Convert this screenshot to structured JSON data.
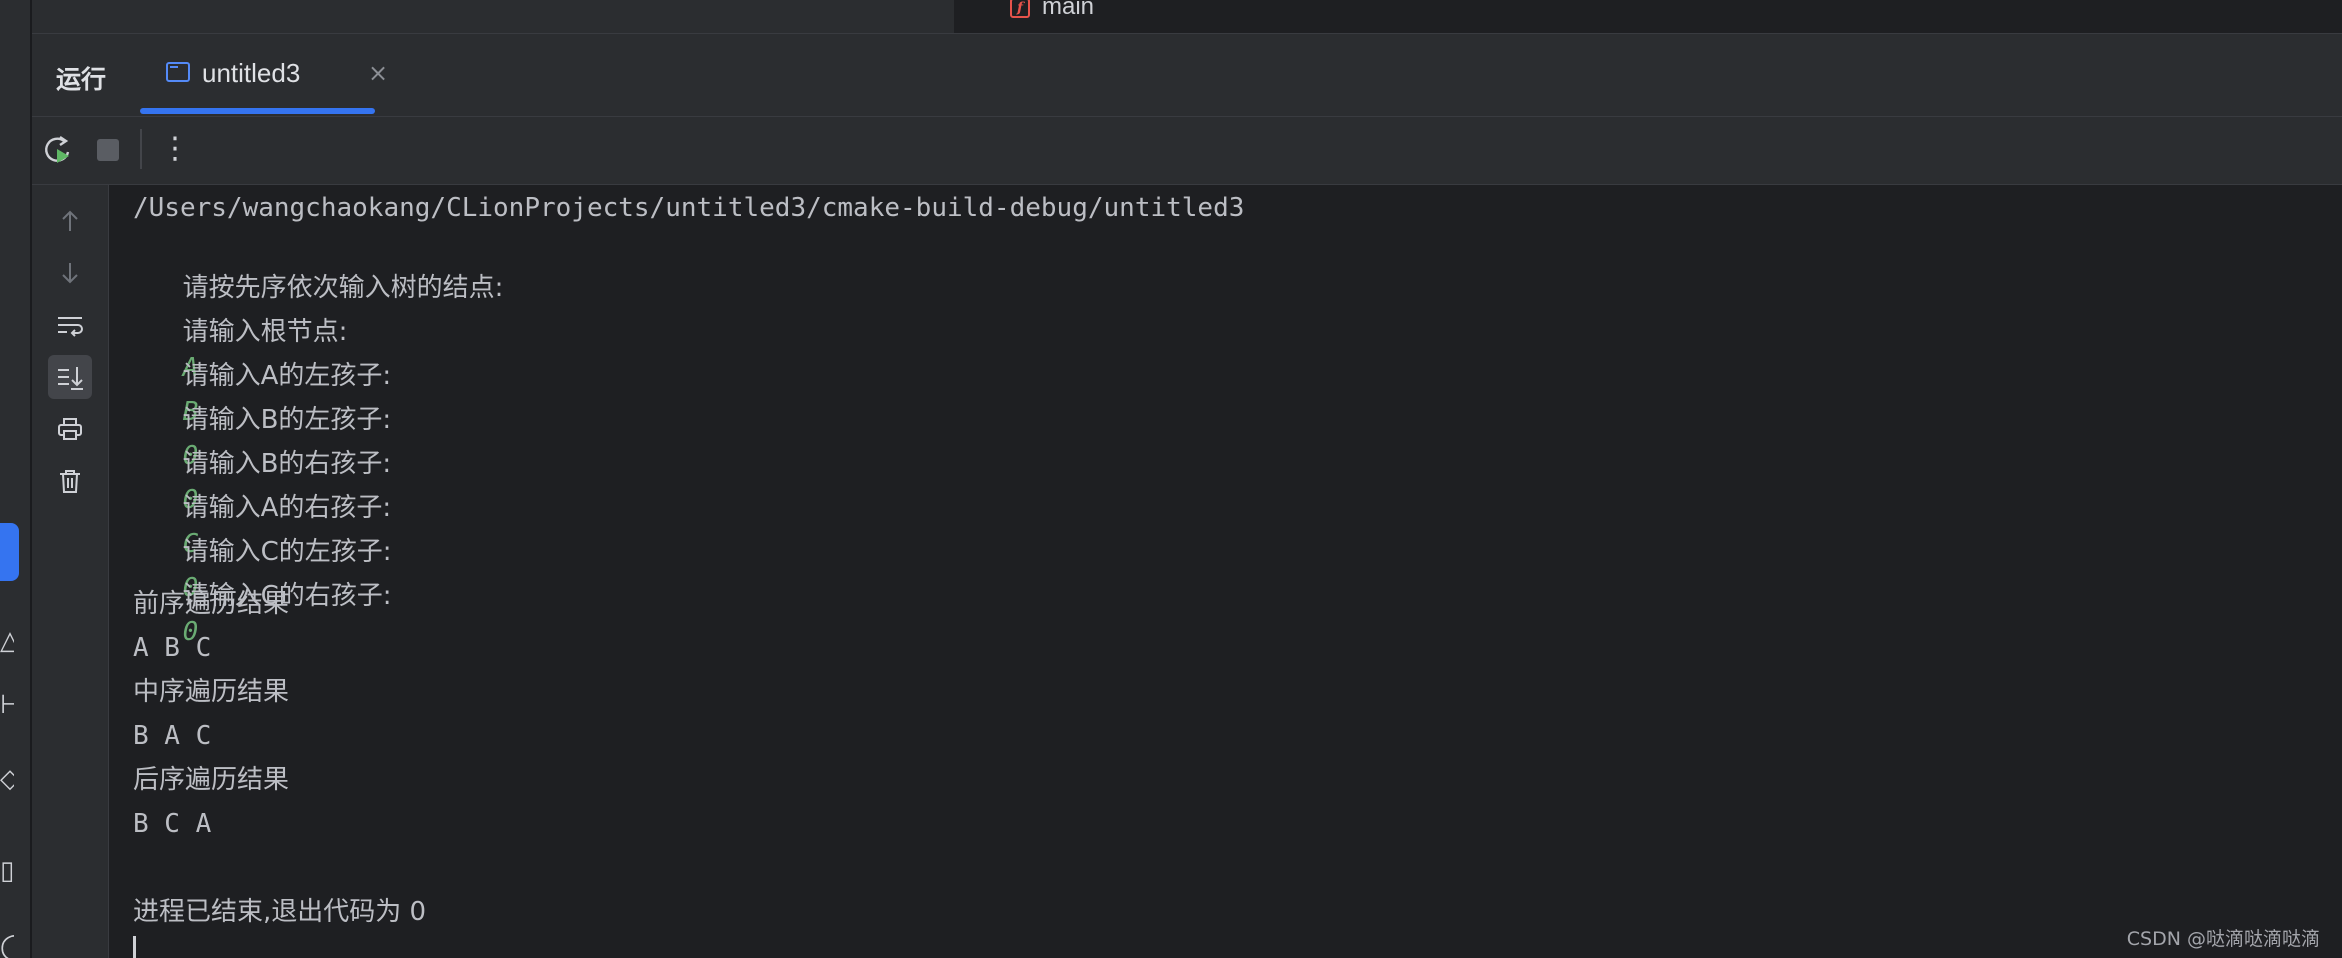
{
  "editor": {
    "tab_label": "main",
    "tab_icon": "function-icon"
  },
  "tool_window": {
    "title": "运行",
    "tab_label": "untitled3",
    "close_glyph": "×",
    "accent_color": "#3574f0"
  },
  "toolbar": {
    "more_glyph": "⋮"
  },
  "console": {
    "path": "/Users/wangchaokang/CLionProjects/untitled3/cmake-build-debug/untitled3",
    "lines": [
      {
        "prompt": "请按先序依次输入树的结点:",
        "input": ""
      },
      {
        "prompt": "请输入根节点:",
        "input": "A"
      },
      {
        "prompt": "请输入A的左孩子:",
        "input": "B"
      },
      {
        "prompt": "请输入B的左孩子:",
        "input": "0"
      },
      {
        "prompt": "请输入B的右孩子:",
        "input": "0"
      },
      {
        "prompt": "请输入A的右孩子:",
        "input": "C"
      },
      {
        "prompt": "请输入C的左孩子:",
        "input": "0"
      },
      {
        "prompt": "请输入C的右孩子:",
        "input": "0"
      }
    ],
    "preorder_label": "前序遍历结果",
    "preorder_result": "A B C",
    "inorder_label": "中序遍历结果",
    "inorder_result": "B A C",
    "postorder_label": "后序遍历结果",
    "postorder_result": "B C A",
    "exit_text": "进程已结束,退出代码为 0",
    "input_color": "#6aab73"
  },
  "watermark": "CSDN @哒滴哒滴哒滴"
}
